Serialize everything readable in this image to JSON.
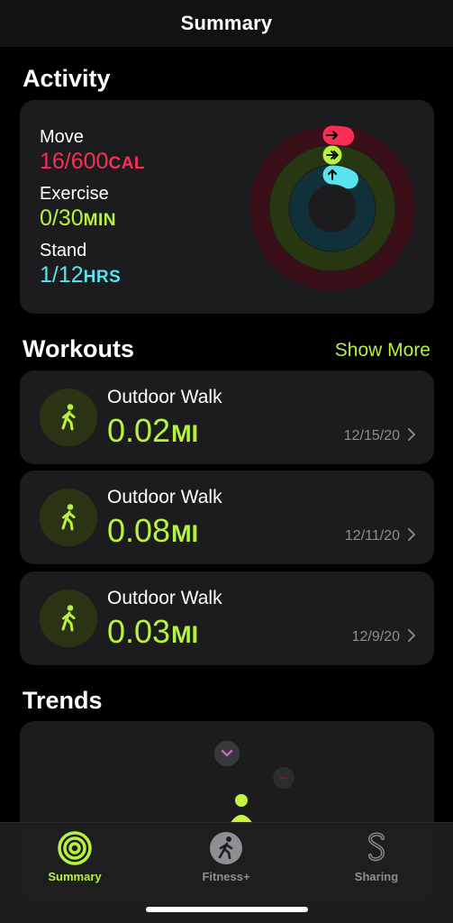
{
  "header": {
    "title": "Summary"
  },
  "activity": {
    "title": "Activity",
    "move": {
      "label": "Move",
      "value": "16/600",
      "unit": "CAL",
      "color": "#fa2e55",
      "fraction": 0.027
    },
    "exercise": {
      "label": "Exercise",
      "value": "0/30",
      "unit": "MIN",
      "color": "#b6f23e",
      "fraction": 0.0
    },
    "stand": {
      "label": "Stand",
      "value": "1/12",
      "unit": "HRS",
      "color": "#59e3ee",
      "fraction": 0.083
    }
  },
  "workouts": {
    "title": "Workouts",
    "show_more": "Show More",
    "items": [
      {
        "name": "Outdoor Walk",
        "distance": "0.02",
        "unit": "MI",
        "date": "12/15/20"
      },
      {
        "name": "Outdoor Walk",
        "distance": "0.08",
        "unit": "MI",
        "date": "12/11/20"
      },
      {
        "name": "Outdoor Walk",
        "distance": "0.03",
        "unit": "MI",
        "date": "12/9/20"
      }
    ]
  },
  "trends": {
    "title": "Trends"
  },
  "tabs": [
    {
      "label": "Summary",
      "icon": "activity-rings-icon",
      "active": true
    },
    {
      "label": "Fitness+",
      "icon": "runner-icon",
      "active": false
    },
    {
      "label": "Sharing",
      "icon": "sharing-icon",
      "active": false
    }
  ],
  "colors": {
    "accent": "#b6f23e",
    "move": "#fa2e55",
    "stand": "#59e3ee"
  }
}
